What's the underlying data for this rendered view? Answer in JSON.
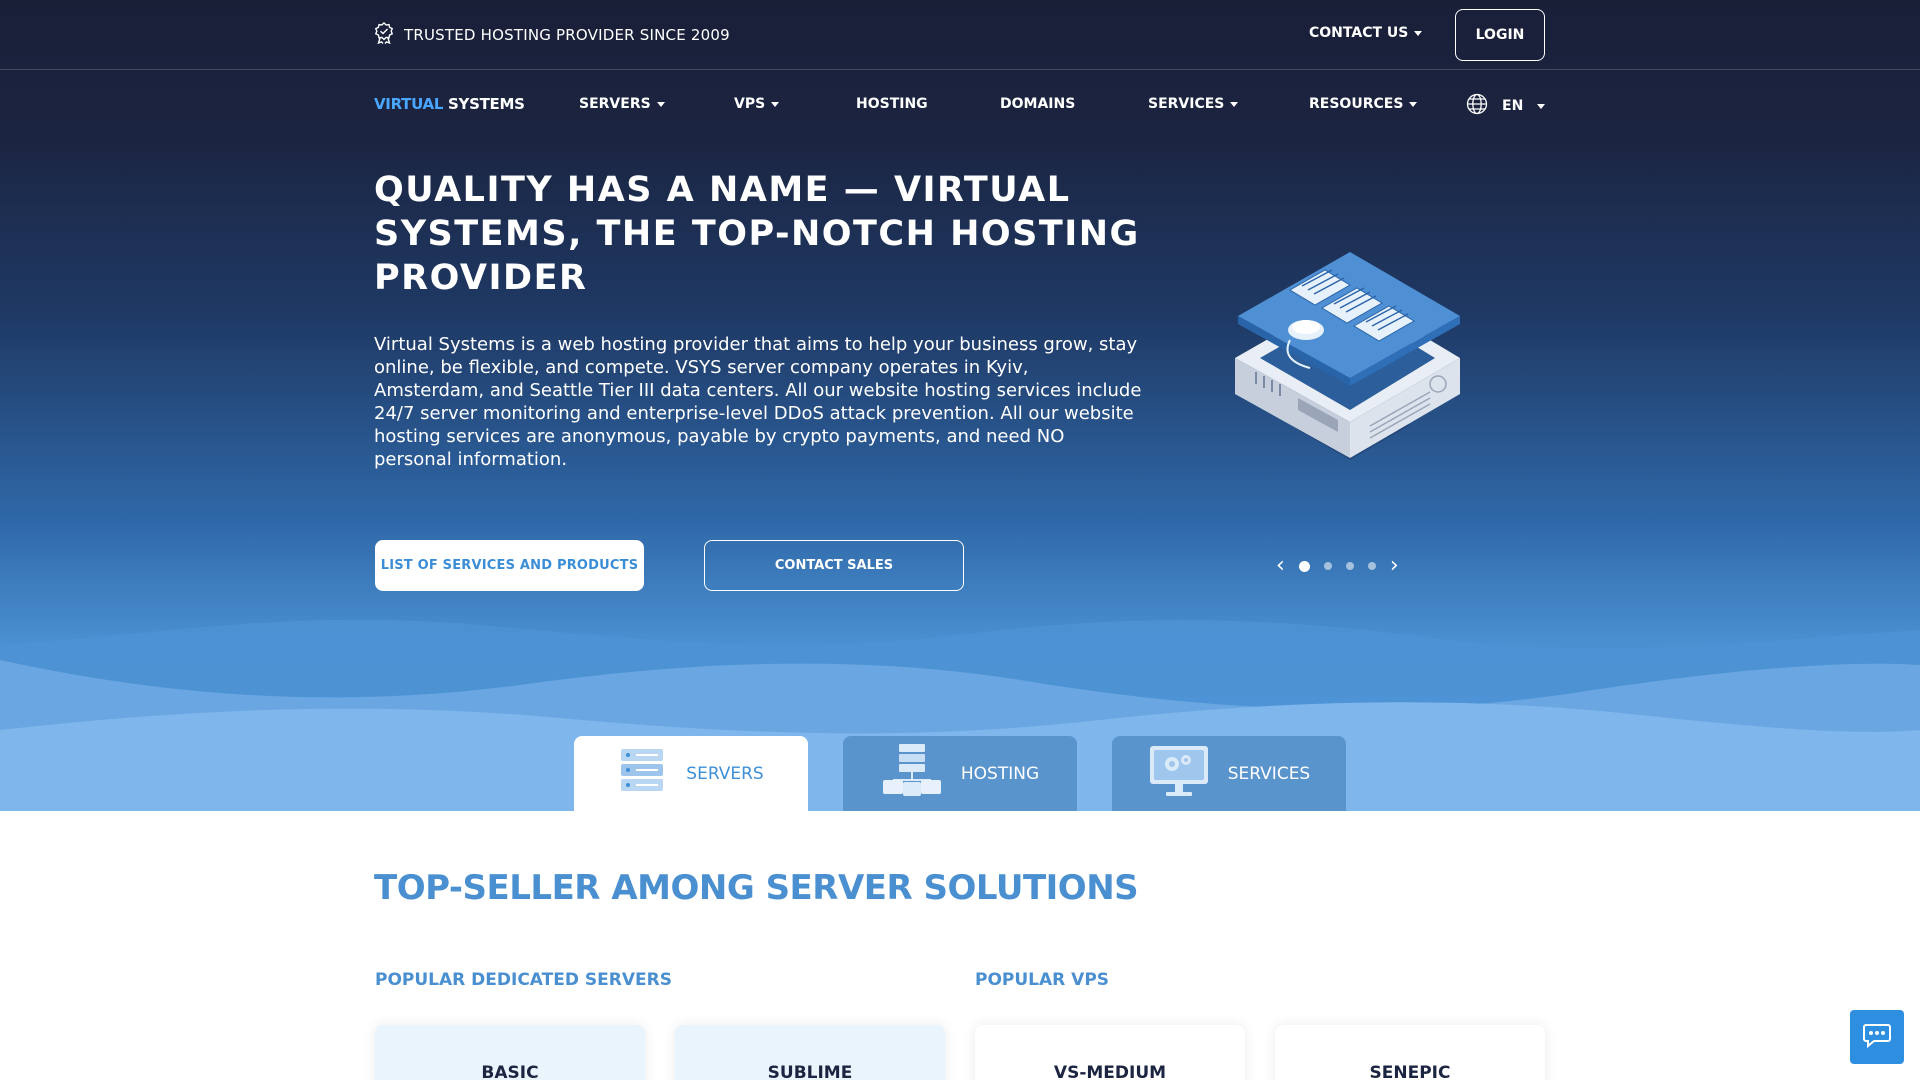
{
  "topbar": {
    "tagline": "TRUSTED HOSTING PROVIDER SINCE 2009",
    "contact_label": "CONTACT US",
    "login_label": "LOGIN"
  },
  "nav": {
    "logo_part1": "VIRTUAL",
    "logo_part2": "SYSTEMS",
    "items": [
      {
        "label": "SERVERS"
      },
      {
        "label": "VPS"
      },
      {
        "label": "HOSTING"
      },
      {
        "label": "DOMAINS"
      },
      {
        "label": "SERVICES"
      },
      {
        "label": "RESOURCES"
      }
    ],
    "language": "EN"
  },
  "hero": {
    "headline": "QUALITY HAS A NAME — VIRTUAL SYSTEMS, THE TOP-NOTCH HOSTING PROVIDER",
    "description": "Virtual Systems is a web hosting provider that aims to help your business grow, stay online, be flexible, and compete. VSYS server company operates in Kyiv, Amsterdam, and Seattle Tier III data centers. All our website hosting services include 24/7 server monitoring and enterprise-level DDoS attack prevention. All our website hosting services are anonymous, payable by crypto payments, and need NO personal information.",
    "primary_button": "LIST OF SERVICES AND PRODUCTS",
    "secondary_button": "CONTACT SALES",
    "carousel_prev": "‹",
    "carousel_next": "›"
  },
  "tabs": [
    {
      "label": "SERVERS"
    },
    {
      "label": "HOSTING"
    },
    {
      "label": "SERVICES"
    }
  ],
  "section": {
    "title": "TOP-SELLER AMONG SERVER SOLUTIONS",
    "dedicated_title": "POPULAR DEDICATED SERVERS",
    "vps_title": "POPULAR VPS",
    "cards": [
      {
        "name": "BASIC"
      },
      {
        "name": "SUBLIME"
      },
      {
        "name": "VS-MEDIUM"
      },
      {
        "name": "SENEPIC"
      }
    ]
  }
}
